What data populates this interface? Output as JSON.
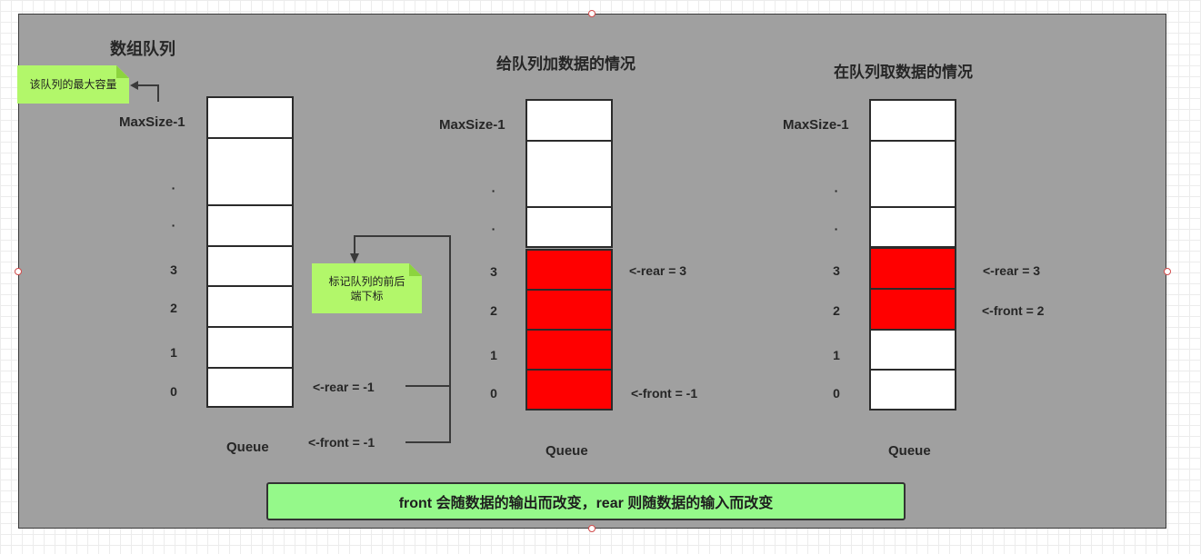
{
  "diagram1": {
    "title": "数组队列",
    "maxsize_label": "MaxSize-1",
    "dot1": "·",
    "dot2": "·",
    "index_labels": [
      "3",
      "2",
      "1",
      "0"
    ],
    "rear_label": "<-rear = -1",
    "front_label": "<-front = -1",
    "queue_label": "Queue",
    "note_capacity": "该队列的最大容量",
    "note_pointer": "标记队列的前后端下标",
    "filled": [
      false,
      false,
      false,
      false,
      false,
      false,
      false
    ]
  },
  "diagram2": {
    "title": "给队列加数据的情况",
    "maxsize_label": "MaxSize-1",
    "dot1": "·",
    "dot2": "·",
    "index_labels": [
      "3",
      "2",
      "1",
      "0"
    ],
    "rear_label": "<-rear = 3",
    "front_label": "<-front = -1",
    "queue_label": "Queue",
    "filled": [
      false,
      false,
      false,
      true,
      true,
      true,
      true
    ]
  },
  "diagram3": {
    "title": "在队列取数据的情况",
    "maxsize_label": "MaxSize-1",
    "dot1": "·",
    "dot2": "·",
    "index_labels": [
      "3",
      "2",
      "1",
      "0"
    ],
    "rear_label": "<-rear = 3",
    "front_label": "<-front = 2",
    "queue_label": "Queue",
    "filled": [
      false,
      false,
      false,
      true,
      true,
      false,
      false
    ]
  },
  "summary": "front 会随数据的输出而改变，rear 则随数据的输入而改变",
  "colors": {
    "panel": "#a0a0a0",
    "filled_cell": "#ff0000",
    "empty_cell": "#ffffff",
    "note": "#b2f76a",
    "summary_box": "#95f98a"
  }
}
